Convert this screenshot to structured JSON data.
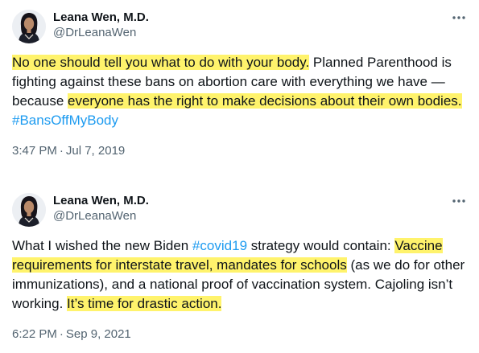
{
  "tweets": [
    {
      "author_name": "Leana Wen, M.D.",
      "handle": "@DrLeanaWen",
      "more_icon": "more-horizontal-icon",
      "body": {
        "hl1": "No one should tell you what to do with your body.",
        "t1": " Planned Parenthood is fighting against these bans on abortion care with everything we have — because ",
        "hl2": "everyone has the right to make decisions about their own bodies.",
        "t2": " ",
        "hashtag": "#BansOffMyBody"
      },
      "time": "3:47 PM",
      "separator": "·",
      "date": "Jul 7, 2019"
    },
    {
      "author_name": "Leana Wen, M.D.",
      "handle": "@DrLeanaWen",
      "more_icon": "more-horizontal-icon",
      "body": {
        "t1": "What I wished the new Biden ",
        "hashtag": "#covid19",
        "t2": " strategy would contain: ",
        "hl1": "Vaccine requirements for interstate travel, mandates for schools",
        "t3": " (as we do for other immunizations), and a national proof of vaccination system. Cajoling isn’t working. ",
        "hl2": "It’s time for drastic action."
      },
      "time": "6:22 PM",
      "separator": "·",
      "date": "Sep 9, 2021"
    }
  ],
  "colors": {
    "text": "#0f1419",
    "secondary": "#536471",
    "link": "#1d9bf0",
    "highlight": "#fff36c"
  }
}
